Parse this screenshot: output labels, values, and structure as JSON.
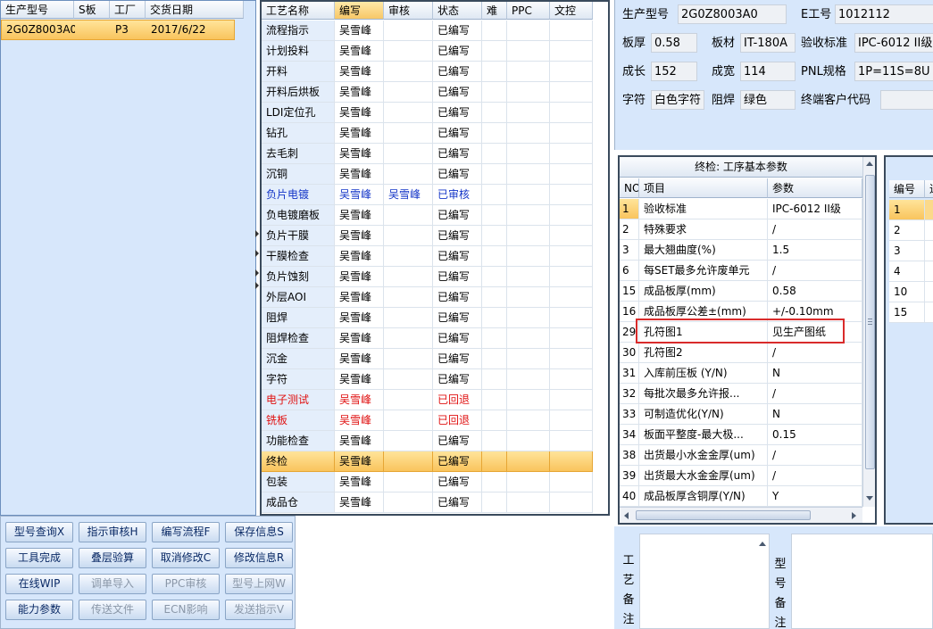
{
  "model_list": {
    "headers": [
      "生产型号",
      "S板",
      "工厂",
      "交货日期"
    ],
    "rows": [
      {
        "model": "2G0Z8003A0",
        "s_board": "",
        "factory": "P3",
        "delivery": "2017/6/22"
      }
    ]
  },
  "process_list": {
    "headers": [
      "工艺名称",
      "编写",
      "审核",
      "状态",
      "难",
      "PPC",
      "文控"
    ],
    "rows": [
      {
        "name": "流程指示",
        "writer": "吴雪峰",
        "reviewer": "",
        "status": "已编写",
        "color": "normal"
      },
      {
        "name": "计划投料",
        "writer": "吴雪峰",
        "reviewer": "",
        "status": "已编写",
        "color": "normal"
      },
      {
        "name": "开料",
        "writer": "吴雪峰",
        "reviewer": "",
        "status": "已编写",
        "color": "normal"
      },
      {
        "name": "开料后烘板",
        "writer": "吴雪峰",
        "reviewer": "",
        "status": "已编写",
        "color": "normal"
      },
      {
        "name": "LDI定位孔",
        "writer": "吴雪峰",
        "reviewer": "",
        "status": "已编写",
        "color": "normal"
      },
      {
        "name": "钻孔",
        "writer": "吴雪峰",
        "reviewer": "",
        "status": "已编写",
        "color": "normal"
      },
      {
        "name": "去毛刺",
        "writer": "吴雪峰",
        "reviewer": "",
        "status": "已编写",
        "color": "normal"
      },
      {
        "name": "沉铜",
        "writer": "吴雪峰",
        "reviewer": "",
        "status": "已编写",
        "color": "normal"
      },
      {
        "name": "负片电镀",
        "writer": "吴雪峰",
        "reviewer": "吴雪峰",
        "status": "已审核",
        "color": "blue"
      },
      {
        "name": "负电镀磨板",
        "writer": "吴雪峰",
        "reviewer": "",
        "status": "已编写",
        "color": "normal"
      },
      {
        "name": "负片干膜",
        "writer": "吴雪峰",
        "reviewer": "",
        "status": "已编写",
        "color": "normal"
      },
      {
        "name": "干膜检查",
        "writer": "吴雪峰",
        "reviewer": "",
        "status": "已编写",
        "color": "normal"
      },
      {
        "name": "负片蚀刻",
        "writer": "吴雪峰",
        "reviewer": "",
        "status": "已编写",
        "color": "normal"
      },
      {
        "name": "外层AOI",
        "writer": "吴雪峰",
        "reviewer": "",
        "status": "已编写",
        "color": "normal"
      },
      {
        "name": "阻焊",
        "writer": "吴雪峰",
        "reviewer": "",
        "status": "已编写",
        "color": "normal"
      },
      {
        "name": "阻焊检查",
        "writer": "吴雪峰",
        "reviewer": "",
        "status": "已编写",
        "color": "normal"
      },
      {
        "name": "沉金",
        "writer": "吴雪峰",
        "reviewer": "",
        "status": "已编写",
        "color": "normal"
      },
      {
        "name": "字符",
        "writer": "吴雪峰",
        "reviewer": "",
        "status": "已编写",
        "color": "normal"
      },
      {
        "name": "电子测试",
        "writer": "吴雪峰",
        "reviewer": "",
        "status": "已回退",
        "color": "red"
      },
      {
        "name": "铣板",
        "writer": "吴雪峰",
        "reviewer": "",
        "status": "已回退",
        "color": "red"
      },
      {
        "name": "功能检查",
        "writer": "吴雪峰",
        "reviewer": "",
        "status": "已编写",
        "color": "normal"
      },
      {
        "name": "终检",
        "writer": "吴雪峰",
        "reviewer": "",
        "status": "已编写",
        "color": "selected"
      },
      {
        "name": "包装",
        "writer": "吴雪峰",
        "reviewer": "",
        "status": "已编写",
        "color": "normal"
      },
      {
        "name": "成品仓",
        "writer": "吴雪峰",
        "reviewer": "",
        "status": "已编写",
        "color": "normal"
      }
    ]
  },
  "buttons": [
    {
      "label": "型号查询X",
      "enabled": true
    },
    {
      "label": "指示审核H",
      "enabled": true
    },
    {
      "label": "编写流程F",
      "enabled": true
    },
    {
      "label": "保存信息S",
      "enabled": true
    },
    {
      "label": "工具完成",
      "enabled": true
    },
    {
      "label": "叠层验算",
      "enabled": true
    },
    {
      "label": "取消修改C",
      "enabled": true
    },
    {
      "label": "修改信息R",
      "enabled": true
    },
    {
      "label": "在线WIP",
      "enabled": true
    },
    {
      "label": "调单导入",
      "enabled": false
    },
    {
      "label": "PPC审核",
      "enabled": false
    },
    {
      "label": "型号上网W",
      "enabled": false
    },
    {
      "label": "能力参数",
      "enabled": true
    },
    {
      "label": "传送文件",
      "enabled": false
    },
    {
      "label": "ECN影响",
      "enabled": false
    },
    {
      "label": "发送指示V",
      "enabled": false
    }
  ],
  "info": {
    "model_label": "生产型号",
    "model_value": "2G0Z8003A0",
    "eng_label": "E工号",
    "eng_value": "1012112",
    "thick_label": "板厚",
    "thick_value": "0.58",
    "material_label": "板材",
    "material_value": "IT-180A",
    "standard_label": "验收标准",
    "standard_value": "IPC-6012 II级",
    "length_label": "成长",
    "length_value": "152",
    "width_label": "成宽",
    "width_value": "114",
    "pnl_label": "PNL规格",
    "pnl_value": "1P=11S=8U",
    "char_label": "字符",
    "char_value": "白色字符",
    "solder_label": "阻焊",
    "solder_value": "绿色",
    "customer_label": "终端客户代码",
    "customer_value": ""
  },
  "params": {
    "title": "终检: 工序基本参数",
    "headers": [
      "NO",
      "项目",
      "参数"
    ],
    "rows": [
      {
        "no": "1",
        "item": "验收标准",
        "value": "IPC-6012 II级"
      },
      {
        "no": "2",
        "item": "特殊要求",
        "value": "/"
      },
      {
        "no": "3",
        "item": "最大翘曲度(%)",
        "value": "1.5"
      },
      {
        "no": "6",
        "item": "每SET最多允许废单元",
        "value": "/"
      },
      {
        "no": "15",
        "item": "成品板厚(mm)",
        "value": "0.58"
      },
      {
        "no": "16",
        "item": "成品板厚公差±(mm)",
        "value": "+/-0.10mm"
      },
      {
        "no": "29",
        "item": "孔符图1",
        "value": "见生产图纸"
      },
      {
        "no": "30",
        "item": "孔符图2",
        "value": "/"
      },
      {
        "no": "31",
        "item": "入库前压板 (Y/N)",
        "value": "N"
      },
      {
        "no": "32",
        "item": "每批次最多允许报...",
        "value": "/"
      },
      {
        "no": "33",
        "item": "可制造优化(Y/N)",
        "value": "N"
      },
      {
        "no": "34",
        "item": "板面平整度-最大极...",
        "value": "0.15"
      },
      {
        "no": "38",
        "item": "出货最小水金金厚(um)",
        "value": "/"
      },
      {
        "no": "39",
        "item": "出货最大水金金厚(um)",
        "value": "/"
      },
      {
        "no": "40",
        "item": "成品板厚含铜厚(Y/N)",
        "value": "Y"
      }
    ]
  },
  "right_panel": {
    "header": "编号",
    "header_cut": "进",
    "rows": [
      "1",
      "2",
      "3",
      "4",
      "10",
      "15"
    ]
  },
  "notes": {
    "process_label": "工艺备注",
    "model_label": "型号备注"
  }
}
